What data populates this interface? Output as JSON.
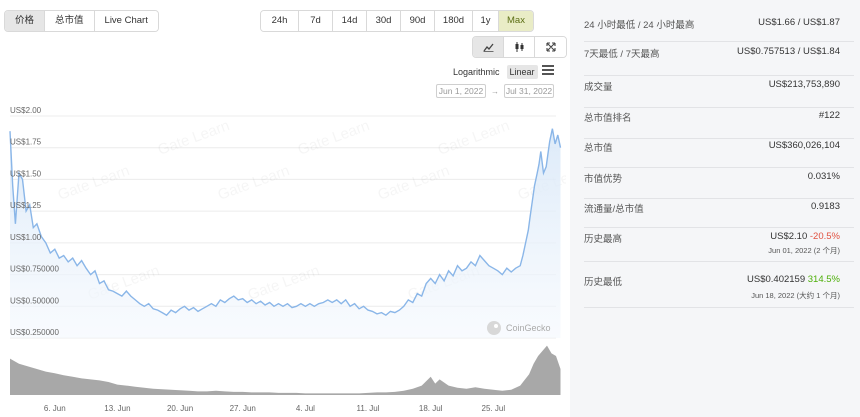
{
  "tabs": [
    {
      "label": "价格",
      "active": true
    },
    {
      "label": "总市值",
      "active": false
    },
    {
      "label": "Live Chart",
      "active": false
    }
  ],
  "ranges": [
    {
      "label": "24h",
      "active": false
    },
    {
      "label": "7d",
      "active": false
    },
    {
      "label": "14d",
      "active": false
    },
    {
      "label": "30d",
      "active": false
    },
    {
      "label": "90d",
      "active": false
    },
    {
      "label": "180d",
      "active": false
    },
    {
      "label": "1y",
      "active": false
    },
    {
      "label": "Max",
      "active": true
    }
  ],
  "chart_types": [
    {
      "icon": "line-chart-icon",
      "active": true
    },
    {
      "icon": "candlestick-icon",
      "active": false
    },
    {
      "icon": "expand-icon",
      "active": false
    }
  ],
  "scale": {
    "log_label": "Logarithmic",
    "linear_label": "Linear",
    "selected": "Linear"
  },
  "date_range": {
    "from": "Jun 1, 2022",
    "to": "Jul 31, 2022",
    "arrow": "→"
  },
  "watermark": {
    "brand": "CoinGecko",
    "gate": "Gate Learn"
  },
  "chart_data": {
    "type": "line",
    "y_ticks": [
      {
        "value": 2.0,
        "label": "US$2.00"
      },
      {
        "value": 1.75,
        "label": "US$1.75"
      },
      {
        "value": 1.5,
        "label": "US$1.50"
      },
      {
        "value": 1.25,
        "label": "US$1.25"
      },
      {
        "value": 1.0,
        "label": "US$1.00"
      },
      {
        "value": 0.75,
        "label": "US$0.750000"
      },
      {
        "value": 0.5,
        "label": "US$0.500000"
      },
      {
        "value": 0.25,
        "label": "US$0.250000"
      }
    ],
    "x_ticks": [
      {
        "day": 6,
        "label": "6. Jun"
      },
      {
        "day": 13,
        "label": "13. Jun"
      },
      {
        "day": 20,
        "label": "20. Jun"
      },
      {
        "day": 27,
        "label": "27. Jun"
      },
      {
        "day": 34,
        "label": "4. Jul"
      },
      {
        "day": 41,
        "label": "11. Jul"
      },
      {
        "day": 48,
        "label": "18. Jul"
      },
      {
        "day": 55,
        "label": "25. Jul"
      }
    ],
    "ylim": [
      0.25,
      2.0
    ],
    "xlim": [
      1,
      62
    ],
    "price": [
      [
        1.0,
        1.88
      ],
      [
        1.3,
        1.45
      ],
      [
        1.6,
        1.15
      ],
      [
        2.0,
        1.55
      ],
      [
        2.4,
        1.5
      ],
      [
        2.8,
        1.25
      ],
      [
        3.2,
        1.3
      ],
      [
        3.6,
        1.12
      ],
      [
        4.0,
        1.15
      ],
      [
        4.5,
        1.05
      ],
      [
        5.0,
        1.0
      ],
      [
        5.5,
        0.92
      ],
      [
        6.0,
        0.95
      ],
      [
        6.5,
        0.88
      ],
      [
        7.0,
        0.9
      ],
      [
        7.5,
        0.85
      ],
      [
        8.0,
        0.88
      ],
      [
        8.5,
        0.82
      ],
      [
        9.0,
        0.86
      ],
      [
        9.5,
        0.8
      ],
      [
        10.0,
        0.75
      ],
      [
        10.5,
        0.78
      ],
      [
        11.0,
        0.68
      ],
      [
        11.5,
        0.7
      ],
      [
        12.0,
        0.63
      ],
      [
        12.5,
        0.62
      ],
      [
        13.0,
        0.6
      ],
      [
        13.5,
        0.58
      ],
      [
        14.0,
        0.62
      ],
      [
        14.5,
        0.58
      ],
      [
        15.0,
        0.55
      ],
      [
        15.5,
        0.52
      ],
      [
        16.0,
        0.5
      ],
      [
        16.5,
        0.52
      ],
      [
        17.0,
        0.48
      ],
      [
        17.5,
        0.47
      ],
      [
        18.0,
        0.45
      ],
      [
        18.5,
        0.43
      ],
      [
        19.0,
        0.47
      ],
      [
        19.5,
        0.45
      ],
      [
        20.0,
        0.48
      ],
      [
        20.5,
        0.5
      ],
      [
        21.0,
        0.47
      ],
      [
        21.5,
        0.49
      ],
      [
        22.0,
        0.46
      ],
      [
        22.5,
        0.48
      ],
      [
        23.0,
        0.5
      ],
      [
        23.5,
        0.52
      ],
      [
        24.0,
        0.5
      ],
      [
        24.5,
        0.55
      ],
      [
        25.0,
        0.53
      ],
      [
        25.5,
        0.56
      ],
      [
        26.0,
        0.58
      ],
      [
        26.5,
        0.55
      ],
      [
        27.0,
        0.56
      ],
      [
        27.5,
        0.53
      ],
      [
        28.0,
        0.55
      ],
      [
        28.5,
        0.52
      ],
      [
        29.0,
        0.54
      ],
      [
        29.5,
        0.51
      ],
      [
        30.0,
        0.53
      ],
      [
        30.5,
        0.5
      ],
      [
        31.0,
        0.52
      ],
      [
        31.5,
        0.5
      ],
      [
        32.0,
        0.52
      ],
      [
        32.5,
        0.49
      ],
      [
        33.0,
        0.5
      ],
      [
        33.5,
        0.52
      ],
      [
        34.0,
        0.5
      ],
      [
        34.5,
        0.52
      ],
      [
        35.0,
        0.5
      ],
      [
        35.5,
        0.52
      ],
      [
        36.0,
        0.53
      ],
      [
        36.5,
        0.55
      ],
      [
        37.0,
        0.53
      ],
      [
        37.5,
        0.55
      ],
      [
        38.0,
        0.52
      ],
      [
        38.5,
        0.55
      ],
      [
        39.0,
        0.5
      ],
      [
        39.5,
        0.52
      ],
      [
        40.0,
        0.48
      ],
      [
        40.5,
        0.5
      ],
      [
        41.0,
        0.47
      ],
      [
        41.5,
        0.46
      ],
      [
        42.0,
        0.44
      ],
      [
        42.5,
        0.45
      ],
      [
        43.0,
        0.43
      ],
      [
        43.5,
        0.46
      ],
      [
        44.0,
        0.45
      ],
      [
        44.5,
        0.47
      ],
      [
        45.0,
        0.5
      ],
      [
        45.5,
        0.55
      ],
      [
        46.0,
        0.53
      ],
      [
        46.5,
        0.6
      ],
      [
        47.0,
        0.58
      ],
      [
        47.5,
        0.68
      ],
      [
        48.0,
        0.72
      ],
      [
        48.5,
        0.68
      ],
      [
        49.0,
        0.75
      ],
      [
        49.5,
        0.7
      ],
      [
        50.0,
        0.78
      ],
      [
        50.5,
        0.74
      ],
      [
        51.0,
        0.82
      ],
      [
        51.5,
        0.78
      ],
      [
        52.0,
        0.8
      ],
      [
        52.5,
        0.85
      ],
      [
        53.0,
        0.82
      ],
      [
        53.5,
        0.9
      ],
      [
        54.0,
        0.86
      ],
      [
        54.5,
        0.82
      ],
      [
        55.0,
        0.8
      ],
      [
        55.5,
        0.78
      ],
      [
        56.0,
        0.75
      ],
      [
        56.5,
        0.8
      ],
      [
        57.0,
        0.77
      ],
      [
        57.5,
        0.8
      ],
      [
        58.0,
        0.82
      ],
      [
        58.3,
        0.9
      ],
      [
        58.6,
        1.0
      ],
      [
        58.9,
        1.1
      ],
      [
        59.1,
        1.2
      ],
      [
        59.3,
        1.3
      ],
      [
        59.6,
        1.45
      ],
      [
        59.9,
        1.55
      ],
      [
        60.1,
        1.62
      ],
      [
        60.3,
        1.72
      ],
      [
        60.6,
        1.55
      ],
      [
        60.9,
        1.6
      ],
      [
        61.1,
        1.7
      ],
      [
        61.3,
        1.8
      ],
      [
        61.6,
        1.9
      ],
      [
        61.9,
        1.78
      ],
      [
        62.2,
        1.85
      ],
      [
        62.5,
        1.75
      ]
    ],
    "volume": [
      [
        1.0,
        0.7
      ],
      [
        2.0,
        0.6
      ],
      [
        3.0,
        0.55
      ],
      [
        4.0,
        0.5
      ],
      [
        5.0,
        0.45
      ],
      [
        6.0,
        0.42
      ],
      [
        7.0,
        0.38
      ],
      [
        8.0,
        0.35
      ],
      [
        9.0,
        0.32
      ],
      [
        10.0,
        0.3
      ],
      [
        11.0,
        0.28
      ],
      [
        12.0,
        0.25
      ],
      [
        13.0,
        0.2
      ],
      [
        14.0,
        0.18
      ],
      [
        15.0,
        0.16
      ],
      [
        16.0,
        0.14
      ],
      [
        17.0,
        0.12
      ],
      [
        18.0,
        0.11
      ],
      [
        19.0,
        0.1
      ],
      [
        20.0,
        0.09
      ],
      [
        21.0,
        0.08
      ],
      [
        22.0,
        0.07
      ],
      [
        23.0,
        0.07
      ],
      [
        24.0,
        0.08
      ],
      [
        25.0,
        0.07
      ],
      [
        26.0,
        0.06
      ],
      [
        27.0,
        0.06
      ],
      [
        28.0,
        0.05
      ],
      [
        29.0,
        0.05
      ],
      [
        30.0,
        0.05
      ],
      [
        31.0,
        0.04
      ],
      [
        32.0,
        0.04
      ],
      [
        33.0,
        0.04
      ],
      [
        34.0,
        0.03
      ],
      [
        35.0,
        0.03
      ],
      [
        36.0,
        0.03
      ],
      [
        37.0,
        0.03
      ],
      [
        38.0,
        0.03
      ],
      [
        39.0,
        0.03
      ],
      [
        40.0,
        0.03
      ],
      [
        41.0,
        0.04
      ],
      [
        42.0,
        0.05
      ],
      [
        43.0,
        0.05
      ],
      [
        44.0,
        0.06
      ],
      [
        45.0,
        0.08
      ],
      [
        46.0,
        0.12
      ],
      [
        47.0,
        0.18
      ],
      [
        48.0,
        0.35
      ],
      [
        48.5,
        0.22
      ],
      [
        49.0,
        0.3
      ],
      [
        50.0,
        0.18
      ],
      [
        51.0,
        0.14
      ],
      [
        52.0,
        0.12
      ],
      [
        53.0,
        0.15
      ],
      [
        54.0,
        0.12
      ],
      [
        55.0,
        0.1
      ],
      [
        56.0,
        0.08
      ],
      [
        57.0,
        0.1
      ],
      [
        58.0,
        0.18
      ],
      [
        59.0,
        0.4
      ],
      [
        59.5,
        0.6
      ],
      [
        60.0,
        0.75
      ],
      [
        60.5,
        0.85
      ],
      [
        61.0,
        0.95
      ],
      [
        61.5,
        0.8
      ],
      [
        62.0,
        0.75
      ],
      [
        62.5,
        0.5
      ]
    ]
  },
  "stats": [
    {
      "label": "24 小时最低 / 24 小时最高",
      "value": "US$1.66 / US$1.87"
    },
    {
      "label": "7天最低 / 7天最高",
      "value": "US$0.757513 / US$1.84"
    },
    {
      "label": "成交量",
      "value": "US$213,753,890"
    },
    {
      "label": "总市值排名",
      "value": "#122"
    },
    {
      "label": "总市值",
      "value": "US$360,026,104"
    },
    {
      "label": "市值优势",
      "value": "0.031%"
    },
    {
      "label": "流通量/总市值",
      "value": "0.9183"
    },
    {
      "label": "历史最高",
      "value": "US$2.10",
      "change": "-20.5%",
      "change_type": "neg",
      "sub": "Jun 01, 2022 (2 个月)"
    },
    {
      "label": "历史最低",
      "value": "US$0.402159",
      "change": "314.5%",
      "change_type": "pos",
      "sub": "Jun 18, 2022 (大约 1 个月)"
    }
  ],
  "colors": {
    "line": "#8ab6e8",
    "area_top": "#d9e8f8",
    "volume": "#a8a8a8",
    "grid": "#e6e6e6",
    "accent_active": "#e9ecc6"
  }
}
